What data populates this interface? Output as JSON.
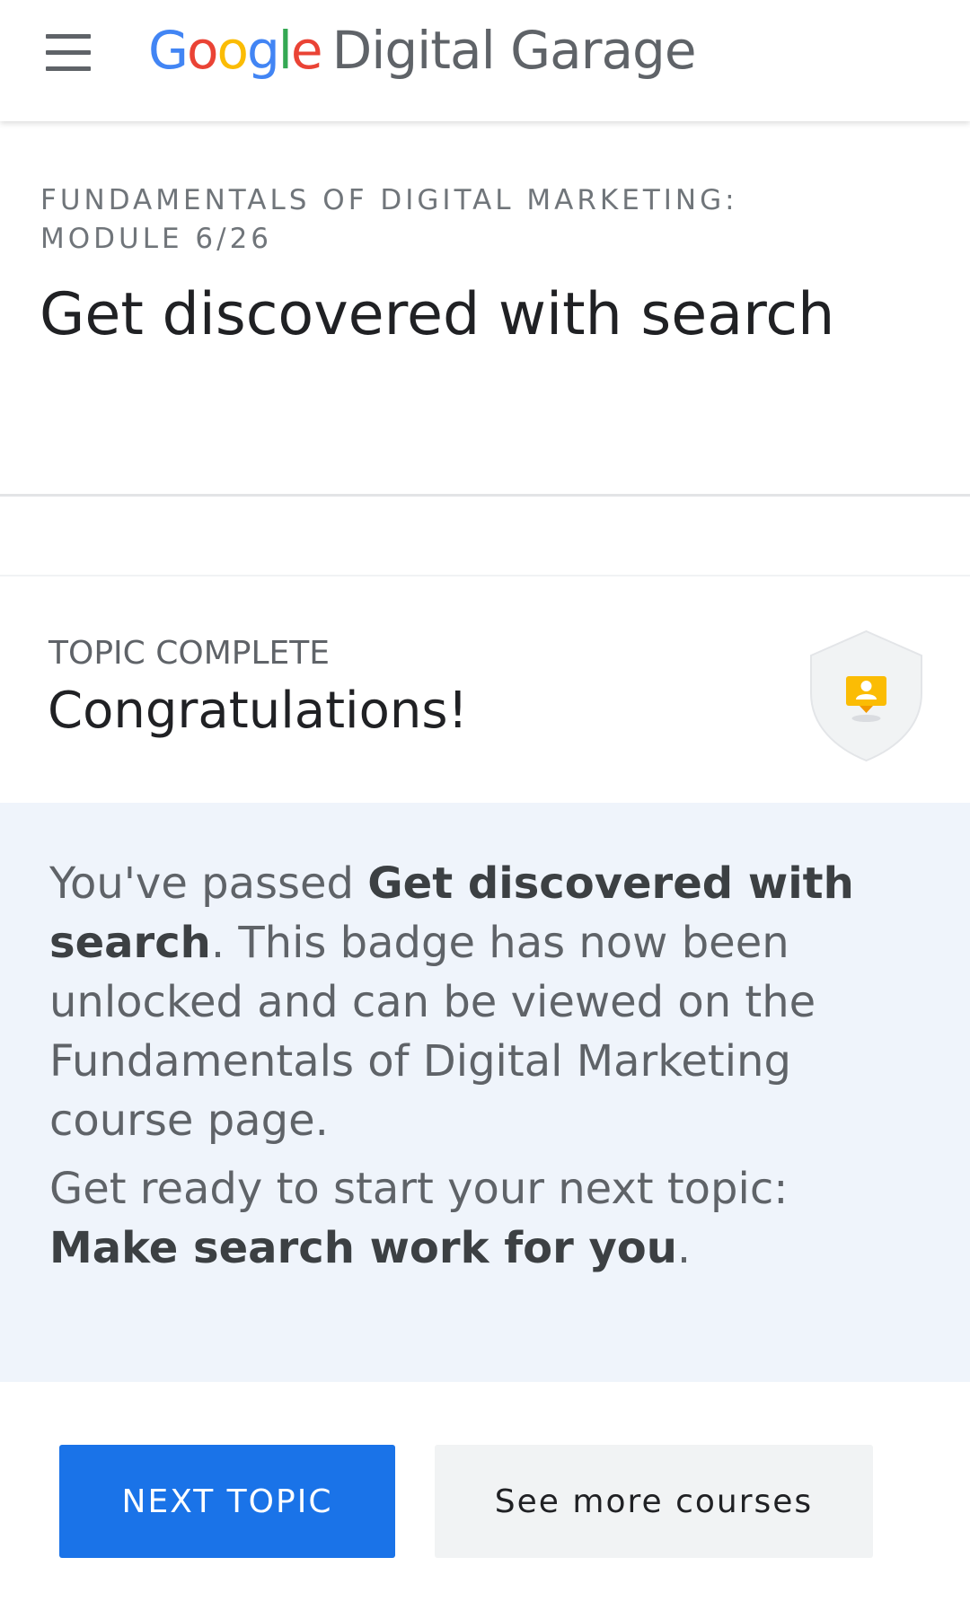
{
  "header": {
    "logo": {
      "google_letters": [
        "G",
        "o",
        "o",
        "g",
        "l",
        "e"
      ],
      "google_colors": [
        "#4285F4",
        "#EA4335",
        "#FBBC05",
        "#4285F4",
        "#34A853",
        "#EA4335"
      ],
      "suffix": "Digital Garage"
    },
    "menu_icon": "hamburger-menu-icon"
  },
  "module": {
    "eyebrow": "FUNDAMENTALS OF DIGITAL MARKETING: MODULE 6/26",
    "title": "Get discovered with search"
  },
  "completion": {
    "status": "TOPIC COMPLETE",
    "heading": "Congratulations!",
    "badge_icon": "topic-badge-icon",
    "message": {
      "passed_prefix": "You've passed ",
      "passed_topic": "Get discovered with search",
      "passed_suffix": ". This badge has now been unlocked and can be viewed on the Fundamentals of Digital Marketing course page.",
      "next_prefix": "Get ready to start your next topic: ",
      "next_topic": "Make search work for you",
      "next_suffix": "."
    }
  },
  "actions": {
    "next_topic": "NEXT TOPIC",
    "see_more": "See more courses"
  },
  "colors": {
    "primary_button": "#1a73e8",
    "message_panel": "#eff4fb",
    "badge_shield": "#f1f3f4",
    "badge_accent": "#fbbc04"
  }
}
